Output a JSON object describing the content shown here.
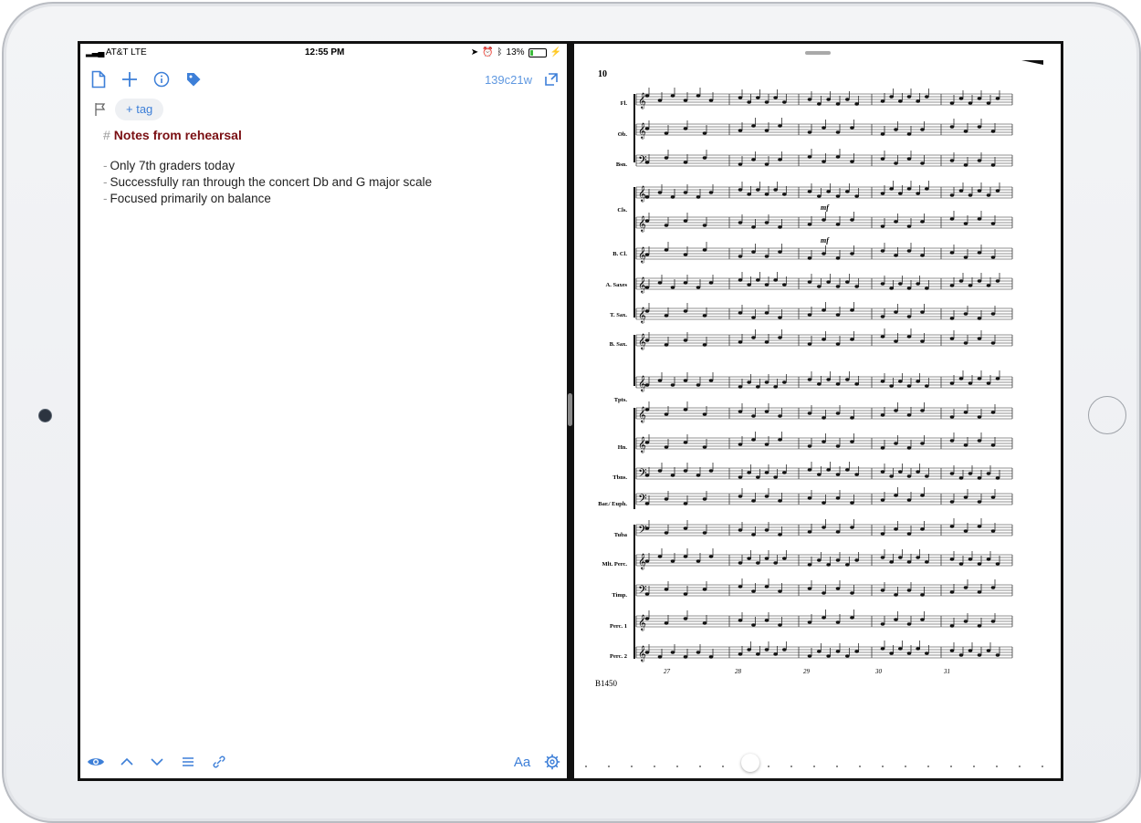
{
  "status_bar": {
    "carrier": "AT&T  LTE",
    "time": "12:55 PM",
    "battery": "13%"
  },
  "toolbar": {
    "note_id": "139c21w"
  },
  "tags": {
    "add_tag_label": "+ tag"
  },
  "note": {
    "heading_marker": "#",
    "heading": "Notes from rehearsal",
    "lines": [
      "Only 7th graders today",
      "Successfully ran through the concert Db and G major scale",
      "Focused primarily on balance"
    ]
  },
  "bottom_bar": {
    "font_label": "Aa"
  },
  "score": {
    "page_number": "10",
    "footer_code": "B1450",
    "instruments": [
      "Fl.",
      "Ob.",
      "Bsn.",
      "Cls.",
      "B. Cl.",
      "A. Saxes",
      "T. Sax.",
      "B. Sax.",
      "Tpts.",
      "Hn.",
      "Tbns.",
      "Bar./ Euph.",
      "Tuba",
      "Mlt. Perc.",
      "Timp.",
      "Perc. 1",
      "Perc. 2"
    ],
    "measure_numbers": [
      "27",
      "28",
      "29",
      "30",
      "31"
    ],
    "dynamic": "mf"
  },
  "accent_color": "#3d7fd8",
  "heading_color": "#7a0f13"
}
